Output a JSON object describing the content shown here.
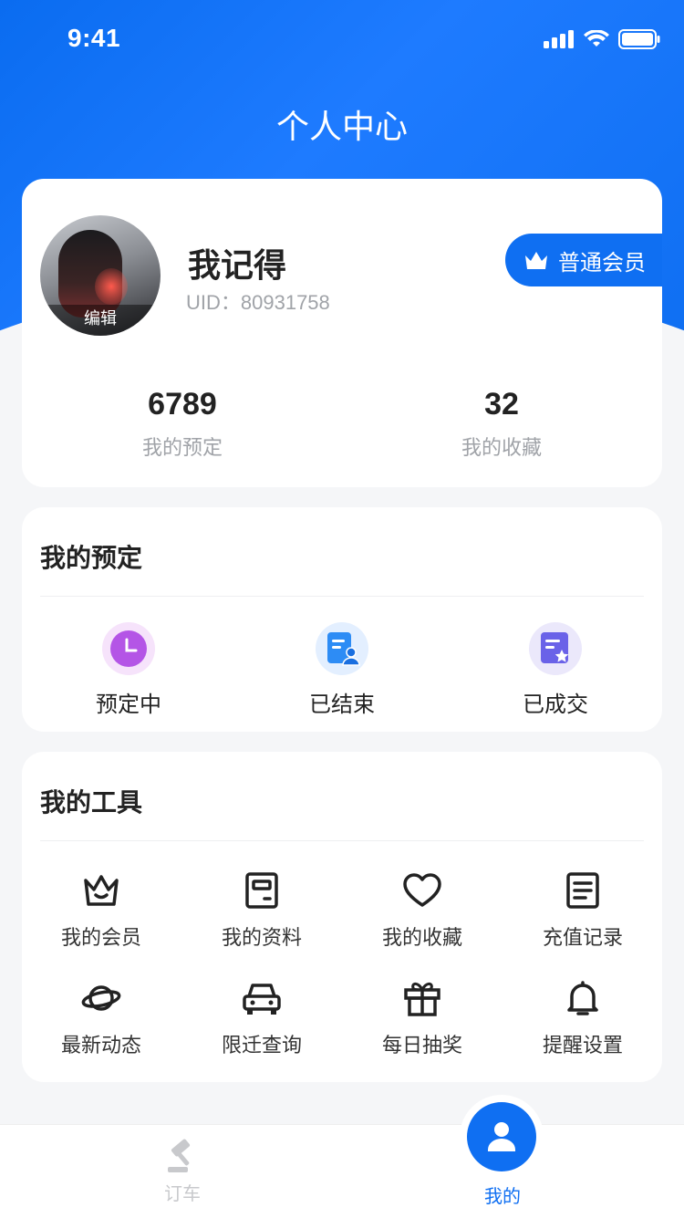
{
  "status_bar": {
    "time": "9:41"
  },
  "page": {
    "title": "个人中心"
  },
  "profile": {
    "avatar_edit_label": "编辑",
    "name": "我记得",
    "uid": "UID：80931758",
    "membership": "普通会员",
    "stats": [
      {
        "value": "6789",
        "label": "我的预定"
      },
      {
        "value": "32",
        "label": "我的收藏"
      }
    ]
  },
  "booking": {
    "title": "我的预定",
    "items": [
      {
        "label": "预定中",
        "icon": "clock-icon"
      },
      {
        "label": "已结束",
        "icon": "document-user-icon"
      },
      {
        "label": "已成交",
        "icon": "document-star-icon"
      }
    ]
  },
  "tools": {
    "title": "我的工具",
    "items": [
      {
        "label": "我的会员",
        "icon": "crown-icon"
      },
      {
        "label": "我的资料",
        "icon": "profile-card-icon"
      },
      {
        "label": "我的收藏",
        "icon": "heart-icon"
      },
      {
        "label": "充值记录",
        "icon": "list-document-icon"
      },
      {
        "label": "最新动态",
        "icon": "planet-icon"
      },
      {
        "label": "限迁查询",
        "icon": "car-icon"
      },
      {
        "label": "每日抽奖",
        "icon": "gift-icon"
      },
      {
        "label": "提醒设置",
        "icon": "bell-icon"
      }
    ]
  },
  "tabbar": {
    "items": [
      {
        "label": "订车",
        "icon": "gavel-icon",
        "active": false
      },
      {
        "label": "我的",
        "icon": "user-icon",
        "active": true
      }
    ]
  },
  "colors": {
    "primary": "#0f6ff2",
    "background": "#f5f6f8",
    "text": "#222222",
    "muted": "#a0a3a8"
  }
}
